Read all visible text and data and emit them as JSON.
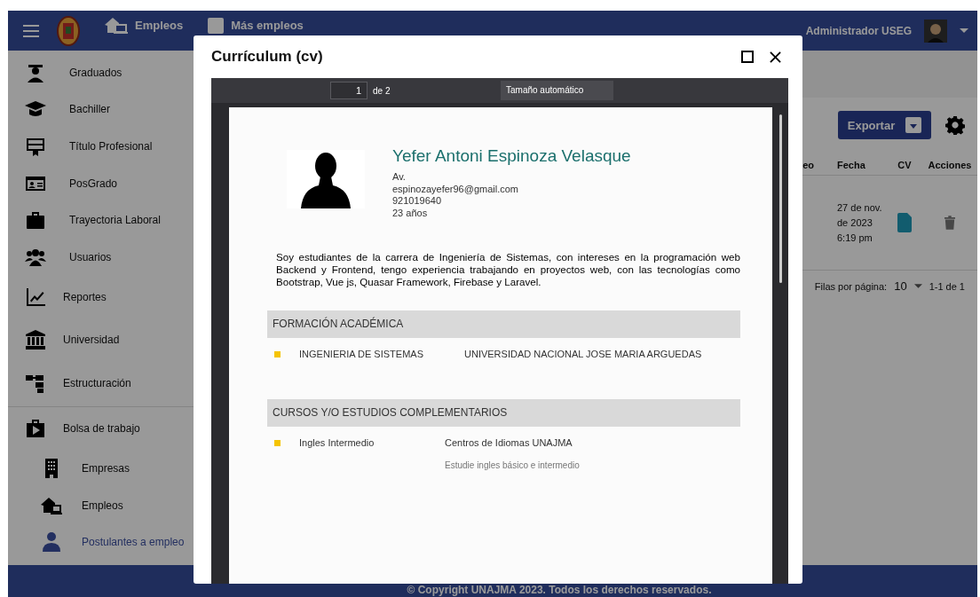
{
  "header": {
    "nav": [
      {
        "label": "Empleos",
        "kind": "jobs"
      },
      {
        "label": "Más empleos",
        "kind": "more"
      }
    ],
    "user": "Administrador USEG"
  },
  "sidebar": {
    "items": [
      {
        "label": "Graduados",
        "kind": "graduate",
        "selected": false
      },
      {
        "label": "Bachiller",
        "kind": "cap",
        "selected": false
      },
      {
        "label": "Título Profesional",
        "kind": "diploma",
        "selected": false
      },
      {
        "label": "PosGrado",
        "kind": "idcard",
        "selected": false
      },
      {
        "label": "Trayectoria Laboral",
        "kind": "briefcase",
        "selected": false
      },
      {
        "label": "Usuarios",
        "kind": "users",
        "selected": false
      },
      {
        "label": "Reportes",
        "kind": "chart",
        "selected": false
      },
      {
        "label": "Universidad",
        "kind": "bank",
        "selected": false
      },
      {
        "label": "Estructuración",
        "kind": "tree",
        "selected": false
      },
      {
        "label": "Bolsa de trabajo",
        "kind": "jobbag",
        "selected": false,
        "children": [
          {
            "label": "Empresas",
            "kind": "building",
            "selected": false
          },
          {
            "label": "Empleos",
            "kind": "jobs",
            "selected": false
          },
          {
            "label": "Postulantes a empleo",
            "kind": "person",
            "selected": true
          }
        ]
      }
    ]
  },
  "toolbar": {
    "export_button": "Exportar"
  },
  "table": {
    "columns": [
      "eo",
      "Fecha",
      "CV",
      "Acciones"
    ],
    "rows": [
      {
        "fecha": "27 de nov. de 2023 6:19 pm"
      }
    ],
    "pagination": {
      "rows_per_page_label": "Filas por página:",
      "rows_per_page": "10",
      "range": "1-1 de 1"
    }
  },
  "footer": "© Copyright UNAJMA 2023. Todos los derechos reservados.",
  "dialog": {
    "title": "Currículum (cv)",
    "viewer": {
      "page": "1",
      "page_count": "de 2",
      "zoom": "Tamaño automático"
    },
    "cv": {
      "name": "Yefer Antoni Espinoza Velasque",
      "details": [
        "Av.",
        "espinozayefer96@gmail.com",
        "921019640",
        "23 años"
      ],
      "summary": "Soy estudiantes de la carrera de Ingeniería de Sistemas, con intereses en la programación web Backend y Frontend, tengo experiencia trabajando en proyectos web, con las tecnologías como Bootstrap, Vue js, Quasar Framework, Firebase y Laravel.",
      "sections": [
        {
          "title": "FORMACIÓN ACADÉMICA",
          "entries": [
            {
              "title": "INGENIERIA DE SISTEMAS",
              "place": "UNIVERSIDAD NACIONAL JOSE MARIA ARGUEDAS"
            }
          ]
        },
        {
          "title": "CURSOS Y/O ESTUDIOS COMPLEMENTARIOS",
          "entries": [
            {
              "title": "Ingles Intermedio",
              "place": "Centros de Idiomas UNAJMA",
              "note": "Estudie ingles básico e intermedio"
            }
          ]
        }
      ]
    }
  }
}
